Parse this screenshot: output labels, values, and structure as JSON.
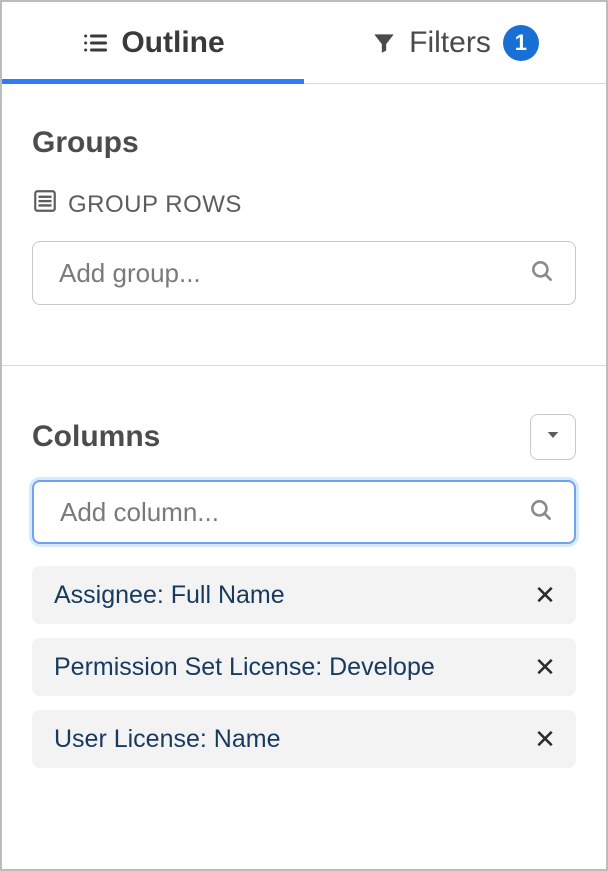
{
  "tabs": {
    "outline": "Outline",
    "filters": "Filters",
    "filters_count": "1"
  },
  "groups": {
    "title": "Groups",
    "subheader": "GROUP ROWS",
    "placeholder": "Add group..."
  },
  "columns": {
    "title": "Columns",
    "placeholder": "Add column...",
    "items": [
      "Assignee: Full Name",
      "Permission Set License: Develope",
      "User License: Name"
    ]
  }
}
